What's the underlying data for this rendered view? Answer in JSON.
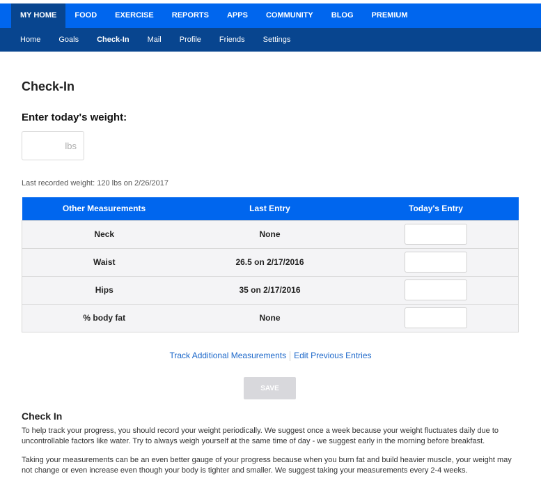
{
  "top_nav": [
    {
      "label": "My Home",
      "active": true
    },
    {
      "label": "Food"
    },
    {
      "label": "Exercise"
    },
    {
      "label": "Reports"
    },
    {
      "label": "Apps"
    },
    {
      "label": "Community"
    },
    {
      "label": "Blog"
    },
    {
      "label": "Premium"
    }
  ],
  "sub_nav": [
    {
      "label": "Home"
    },
    {
      "label": "Goals"
    },
    {
      "label": "Check-In",
      "active": true
    },
    {
      "label": "Mail"
    },
    {
      "label": "Profile"
    },
    {
      "label": "Friends"
    },
    {
      "label": "Settings"
    }
  ],
  "page_title": "Check-In",
  "weight": {
    "label": "Enter today's weight:",
    "placeholder": "lbs",
    "value": "",
    "last_recorded": "Last recorded weight: 120 lbs on 2/26/2017"
  },
  "measurements": {
    "headers": [
      "Other Measurements",
      "Last Entry",
      "Today's Entry"
    ],
    "rows": [
      {
        "name": "Neck",
        "last": "None"
      },
      {
        "name": "Waist",
        "last": "26.5 on 2/17/2016"
      },
      {
        "name": "Hips",
        "last": "35 on 2/17/2016"
      },
      {
        "name": "% body fat",
        "last": "None"
      }
    ]
  },
  "links": {
    "track": "Track Additional Measurements",
    "edit": "Edit Previous Entries"
  },
  "save_label": "Save",
  "info": {
    "title": "Check In",
    "p1": "To help track your progress, you should record your weight periodically. We suggest once a week because your weight fluctuates daily due to uncontrollable factors like water. Try to always weigh yourself at the same time of day - we suggest early in the morning before breakfast.",
    "p2": "Taking your measurements can be an even better gauge of your progress because when you burn fat and build heavier muscle, your weight may not change or even increase even though your body is tighter and smaller. We suggest taking your measurements every 2-4 weeks."
  },
  "colors": {
    "primary_nav": "#0066ee",
    "secondary_nav": "#08458f",
    "link": "#1a66c9",
    "save_disabled": "#d8d8dc"
  }
}
